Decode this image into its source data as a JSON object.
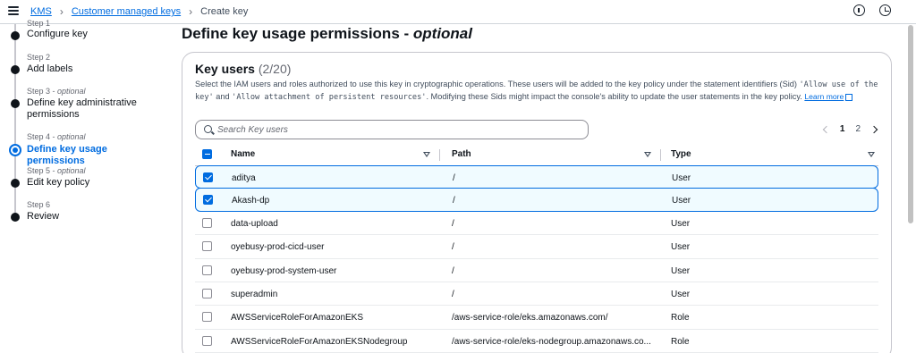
{
  "breadcrumb": {
    "items": [
      "KMS",
      "Customer managed keys"
    ],
    "current": "Create key"
  },
  "wizard": {
    "steps": [
      {
        "num": "Step 1",
        "title": "Configure key"
      },
      {
        "num": "Step 2",
        "title": "Add labels"
      },
      {
        "num": "Step 3",
        "optional": "optional",
        "title": "Define key administrative permissions"
      },
      {
        "num": "Step 4",
        "optional": "optional",
        "title": "Define key usage permissions"
      },
      {
        "num": "Step 5",
        "optional": "optional",
        "title": "Edit key policy"
      },
      {
        "num": "Step 6",
        "title": "Review"
      }
    ]
  },
  "page": {
    "title": "Define key usage permissions",
    "title_optional": "optional"
  },
  "key_users": {
    "header": "Key users",
    "count": "(2/20)",
    "desc_1": "Select the IAM users and roles authorized to use this key in cryptographic operations. These users will be added to the key policy under the statement identifiers (Sid) ",
    "sid_1": "'Allow use of the key'",
    "desc_and": " and ",
    "sid_2": "'Allow attachment of persistent resources'",
    "desc_2": ". Modifying these Sids might impact the console's ability to update the user statements in the key policy.",
    "learn_more": "Learn more",
    "search_placeholder": "Search Key users",
    "pages": [
      "1",
      "2"
    ],
    "columns": {
      "name": "Name",
      "path": "Path",
      "type": "Type"
    },
    "rows": [
      {
        "name": "aditya",
        "path": "/",
        "type": "User",
        "checked": true
      },
      {
        "name": "Akash-dp",
        "path": "/",
        "type": "User",
        "checked": true
      },
      {
        "name": "data-upload",
        "path": "/",
        "type": "User",
        "checked": false
      },
      {
        "name": "oyebusy-prod-cicd-user",
        "path": "/",
        "type": "User",
        "checked": false
      },
      {
        "name": "oyebusy-prod-system-user",
        "path": "/",
        "type": "User",
        "checked": false
      },
      {
        "name": "superadmin",
        "path": "/",
        "type": "User",
        "checked": false
      },
      {
        "name": "AWSServiceRoleForAmazonEKS",
        "path": "/aws-service-role/eks.amazonaws.com/",
        "type": "Role",
        "checked": false
      },
      {
        "name": "AWSServiceRoleForAmazonEKSNodegroup",
        "path": "/aws-service-role/eks-nodegroup.amazonaws.co...",
        "type": "Role",
        "checked": false
      }
    ]
  },
  "colors": {
    "accent": "#006ce0",
    "selected_bg": "#f0fbff"
  }
}
